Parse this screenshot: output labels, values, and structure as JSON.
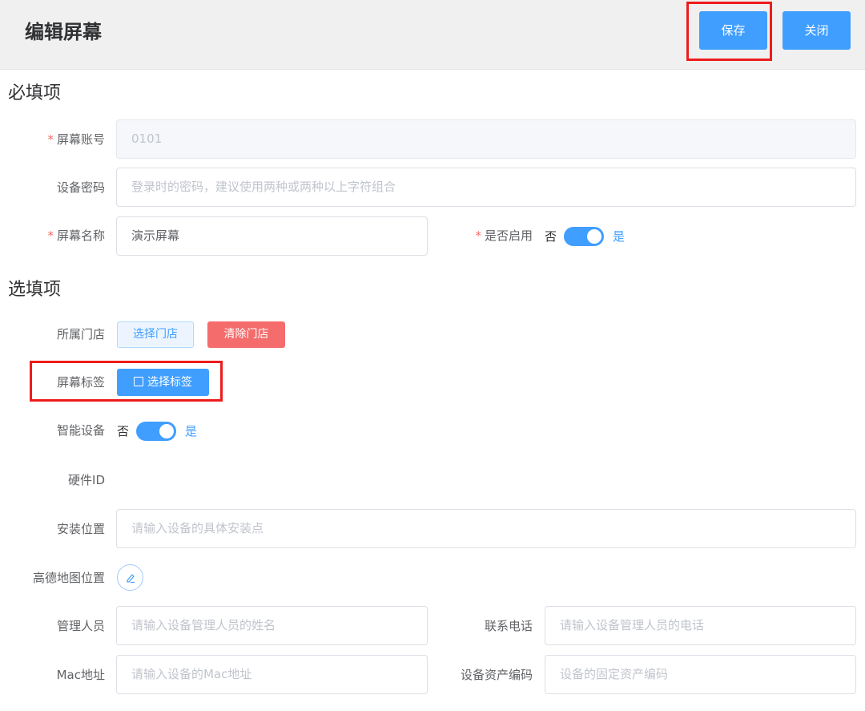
{
  "header": {
    "title": "编辑屏幕",
    "save_label": "保存",
    "close_label": "关闭"
  },
  "required_section": {
    "title": "必填项",
    "screen_account": {
      "label": "屏幕账号",
      "value": "0101"
    },
    "device_password": {
      "label": "设备密码",
      "placeholder": "登录时的密码，建议使用两种或两种以上字符组合"
    },
    "screen_name": {
      "label": "屏幕名称",
      "value": "演示屏幕"
    },
    "enabled": {
      "label": "是否启用",
      "off_text": "否",
      "on_text": "是",
      "state": "on"
    }
  },
  "optional_section": {
    "title": "选填项",
    "store": {
      "label": "所属门店",
      "select_label": "选择门店",
      "clear_label": "清除门店"
    },
    "tags": {
      "label": "屏幕标签",
      "button_label": "选择标签"
    },
    "smart_device": {
      "label": "智能设备",
      "off_text": "否",
      "on_text": "是",
      "state": "on"
    },
    "hardware_id": {
      "label": "硬件ID"
    },
    "install_location": {
      "label": "安装位置",
      "placeholder": "请输入设备的具体安装点"
    },
    "amap_location": {
      "label": "高德地图位置"
    },
    "manager": {
      "label": "管理人员",
      "placeholder": "请输入设备管理人员的姓名"
    },
    "phone": {
      "label": "联系电话",
      "placeholder": "请输入设备管理人员的电话"
    },
    "mac": {
      "label": "Mac地址",
      "placeholder": "请输入设备的Mac地址"
    },
    "asset_code": {
      "label": "设备资产编码",
      "placeholder": "设备的固定资产编码"
    }
  },
  "colors": {
    "primary": "#409eff",
    "danger": "#f56c6c",
    "required": "#f56c6c",
    "highlight": "#ee1c1c"
  }
}
